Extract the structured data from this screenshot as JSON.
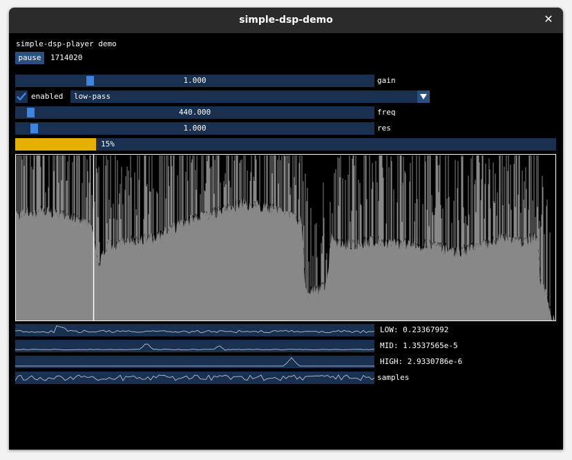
{
  "window": {
    "title": "simple-dsp-demo"
  },
  "header": {
    "text": "simple-dsp-player demo"
  },
  "transport": {
    "pause_label": "pause",
    "sample_position": "1714020"
  },
  "gain": {
    "value_text": "1.000",
    "label": "gain",
    "value": 1.0,
    "fraction": 0.2
  },
  "filter": {
    "enabled_label": "enabled",
    "enabled": true,
    "type": "low-pass",
    "freq": {
      "value_text": "440.000",
      "label": "freq",
      "value": 440.0,
      "fraction": 0.03
    },
    "res": {
      "value_text": "1.000",
      "label": "res",
      "value": 1.0,
      "fraction": 0.04
    }
  },
  "progress": {
    "text": "15%",
    "value": 0.15
  },
  "waveform": {
    "playhead_fraction": 0.145
  },
  "bands": [
    {
      "label": "LOW: 0.23367992"
    },
    {
      "label": "MID: 1.3537565e-5"
    },
    {
      "label": "HIGH: 2.9330786e-6"
    },
    {
      "label": "samples"
    }
  ],
  "colors": {
    "frame_bg": "#1a3050",
    "button": "#2a5080",
    "grab": "#3d85e0",
    "progress": "#e6b000",
    "waveform": "#888888",
    "plot_line": "#a8b4c4"
  }
}
